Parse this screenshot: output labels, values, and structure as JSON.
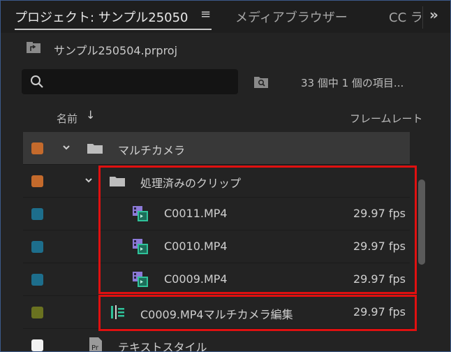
{
  "tabs": {
    "project": "プロジェクト: サンプル25050",
    "media_browser": "メディアブラウザー",
    "cc": "CC ラ",
    "menu_icon": "≡",
    "overflow_icon": "»"
  },
  "project": {
    "file_name": "サンプル250504.prproj"
  },
  "search": {
    "placeholder": "",
    "count": "33 個中 1 個の項目..."
  },
  "columns": {
    "name": "名前",
    "sort_arrow": "↓",
    "frame_rate": "フレームレート"
  },
  "items": [
    {
      "label": "マルチカメラ",
      "type": "folder",
      "color": "#c46a2c",
      "indent": 0,
      "expanded": true,
      "fps": ""
    },
    {
      "label": "処理済みのクリップ",
      "type": "folder",
      "color": "#c46a2c",
      "indent": 1,
      "expanded": true,
      "fps": ""
    },
    {
      "label": "C0011.MP4",
      "type": "clip",
      "color": "#1d6e8c",
      "indent": 2,
      "fps": "29.97 fps"
    },
    {
      "label": "C0010.MP4",
      "type": "clip",
      "color": "#1d6e8c",
      "indent": 2,
      "fps": "29.97 fps"
    },
    {
      "label": "C0009.MP4",
      "type": "clip",
      "color": "#1d6e8c",
      "indent": 2,
      "fps": "29.97 fps"
    },
    {
      "label": "C0009.MP4マルチカメラ編集",
      "type": "multicam",
      "color": "#6a7220",
      "indent": 1,
      "fps": "29.97 fps"
    },
    {
      "label": "テキストスタイル",
      "type": "text-style",
      "color": "#f2f2f2",
      "indent": 0,
      "fps": ""
    }
  ],
  "colors": {
    "highlight": "#e01010",
    "panel_bg": "#232323",
    "selected_row": "#383838"
  }
}
